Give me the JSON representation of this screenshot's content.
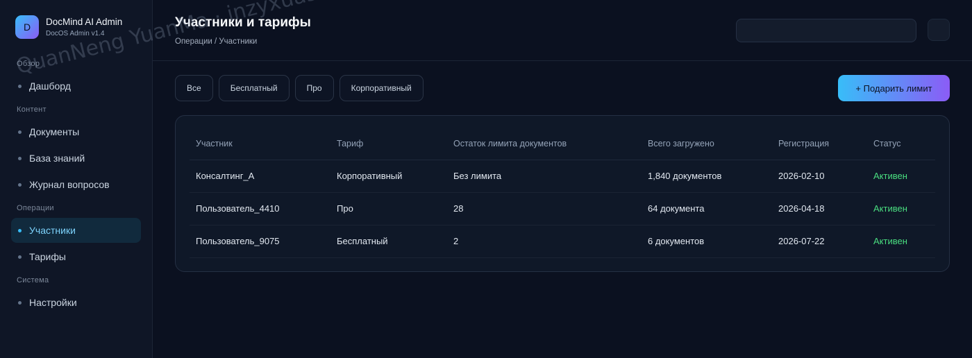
{
  "brand": {
    "logo_letter": "D",
    "title": "DocMind AI Admin",
    "subtitle": "DocOS Admin v1.4"
  },
  "sidebar": {
    "sections": [
      {
        "label": "Обзор",
        "items": [
          {
            "label": "Дашборд",
            "active": false
          }
        ]
      },
      {
        "label": "Контент",
        "items": [
          {
            "label": "Документы",
            "active": false
          },
          {
            "label": "База знаний",
            "active": false
          },
          {
            "label": "Журнал вопросов",
            "active": false
          }
        ]
      },
      {
        "label": "Операции",
        "items": [
          {
            "label": "Участники",
            "active": true
          },
          {
            "label": "Тарифы",
            "active": false
          }
        ]
      },
      {
        "label": "Система",
        "items": [
          {
            "label": "Настройки",
            "active": false
          }
        ]
      }
    ]
  },
  "header": {
    "title": "Участники и тарифы",
    "breadcrumb": "Операции / Участники"
  },
  "filters": [
    "Все",
    "Бесплатный",
    "Про",
    "Корпоративный"
  ],
  "actions": {
    "gift_limit": "+ Подарить лимит"
  },
  "table": {
    "columns": [
      "Участник",
      "Тариф",
      "Остаток лимита документов",
      "Всего загружено",
      "Регистрация",
      "Статус"
    ],
    "rows": [
      [
        "Консалтинг_A",
        "Корпоративный",
        "Без лимита",
        "1,840 документов",
        "2026-02-10",
        "Активен"
      ],
      [
        "Пользователь_4410",
        "Про",
        "28",
        "64 документа",
        "2026-04-18",
        "Активен"
      ],
      [
        "Пользователь_9075",
        "Бесплатный",
        "2",
        "6 документов",
        "2026-07-22",
        "Активен"
      ]
    ]
  },
  "watermark": "QuanNeng YuanMa · inzyxuashop.com",
  "colors": {
    "accent_start": "#38bdf8",
    "accent_end": "#8b5cf6",
    "status_active": "#4ade80",
    "background": "#0b1120"
  }
}
